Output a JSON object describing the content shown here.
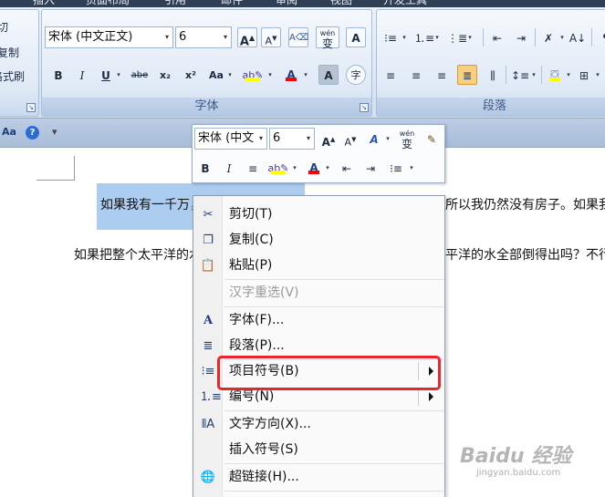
{
  "tabs": [
    {
      "label": "插入",
      "active": false
    },
    {
      "label": "页面布局",
      "active": false
    },
    {
      "label": "引用",
      "active": false
    },
    {
      "label": "邮件",
      "active": false
    },
    {
      "label": "审阅",
      "active": false
    },
    {
      "label": "视图",
      "active": false
    },
    {
      "label": "开发工具",
      "active": false
    }
  ],
  "clipboard": {
    "cut": "切",
    "copy": "复制",
    "format_painter": "格式刷"
  },
  "font_group": {
    "label": "字体",
    "font_name": "宋体 (中文正文)",
    "font_size": "6",
    "grow": "A",
    "shrink": "A",
    "phonetic": "wén",
    "phonetic_char": "变",
    "border_char": "A",
    "bold": "B",
    "italic": "I",
    "underline": "U",
    "strike": "abe",
    "subscript": "x₂",
    "superscript": "x²",
    "change_case": "Aa",
    "font_color": "A",
    "shading": "A",
    "enclose": "字",
    "highlight_color": "#ffff00",
    "font_color_value": "#ff0000"
  },
  "paragraph_group": {
    "label": "段落"
  },
  "qat": {
    "aa": "Aa",
    "help": "?",
    "more": "▾"
  },
  "document": {
    "para1_selected": "如果我有一千万，",
    "para1_rest": "所以我仍然没有房子。如果我",
    "para2_start": "如果把整个太平洋的水",
    "para2_rest": "平洋的水全部倒得出吗？不行"
  },
  "mini_toolbar": {
    "font_name": "宋体 (中文",
    "font_size": "6",
    "grow": "A",
    "shrink": "A",
    "styles": "A",
    "phonetic": "wén",
    "phonetic_char": "变",
    "bold": "B",
    "italic": "I",
    "font_color": "A"
  },
  "context_menu": {
    "items": [
      {
        "icon": "scissors-icon",
        "label": "剪切(T)",
        "disabled": false
      },
      {
        "icon": "copy-icon",
        "label": "复制(C)",
        "disabled": false
      },
      {
        "icon": "paste-icon",
        "label": "粘贴(P)",
        "disabled": false
      },
      {
        "icon": "",
        "label": "汉字重选(V)",
        "disabled": true
      },
      {
        "icon": "font-icon",
        "label": "字体(F)...",
        "disabled": false
      },
      {
        "icon": "paragraph-icon",
        "label": "段落(P)...",
        "disabled": false
      },
      {
        "icon": "bullets-icon",
        "label": "项目符号(B)",
        "disabled": false,
        "submenu": true
      },
      {
        "icon": "numbering-icon",
        "label": "编号(N)",
        "disabled": false,
        "submenu": true
      },
      {
        "icon": "text-direction-icon",
        "label": "文字方向(X)...",
        "disabled": false
      },
      {
        "icon": "",
        "label": "插入符号(S)",
        "disabled": false
      },
      {
        "icon": "hyperlink-icon",
        "label": "超链接(H)...",
        "disabled": false
      }
    ]
  },
  "watermark": {
    "brand": "Baidu 经验",
    "site": "jingyan.baidu.com"
  },
  "colors": {
    "accent_red": "#e8262b",
    "selection": "#adcdf0"
  }
}
